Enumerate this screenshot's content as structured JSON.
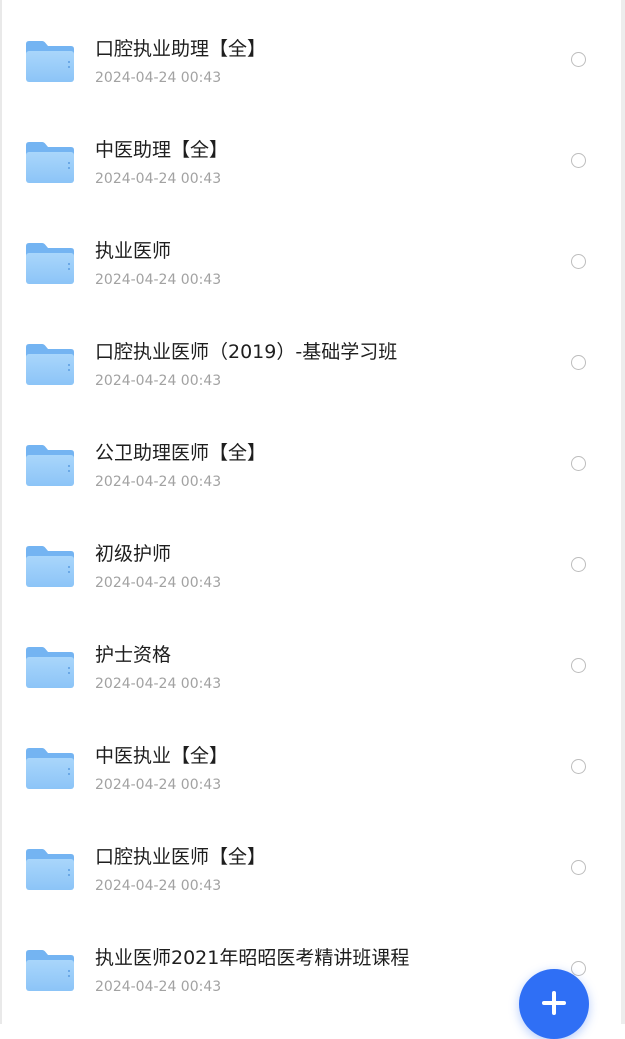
{
  "icons": {
    "item": "folder-icon",
    "select": "radio-circle-icon",
    "fab": "plus-icon"
  },
  "colors": {
    "folder_light": "#9fd0fa",
    "folder_dark": "#72b5f3",
    "accent": "#2f6ff5",
    "date_text": "#a2a2a2"
  },
  "files": [
    {
      "name": "口腔执业助理【全】",
      "date": "2024-04-24 00:43"
    },
    {
      "name": "中医助理【全】",
      "date": "2024-04-24 00:43"
    },
    {
      "name": "执业医师",
      "date": "2024-04-24 00:43"
    },
    {
      "name": "口腔执业医师（2019）-基础学习班",
      "date": "2024-04-24 00:43"
    },
    {
      "name": "公卫助理医师【全】",
      "date": "2024-04-24 00:43"
    },
    {
      "name": "初级护师",
      "date": "2024-04-24 00:43"
    },
    {
      "name": "护士资格",
      "date": "2024-04-24 00:43"
    },
    {
      "name": "中医执业【全】",
      "date": "2024-04-24 00:43"
    },
    {
      "name": "口腔执业医师【全】",
      "date": "2024-04-24 00:43"
    },
    {
      "name": "执业医师2021年昭昭医考精讲班课程",
      "date": "2024-04-24 00:43"
    }
  ]
}
